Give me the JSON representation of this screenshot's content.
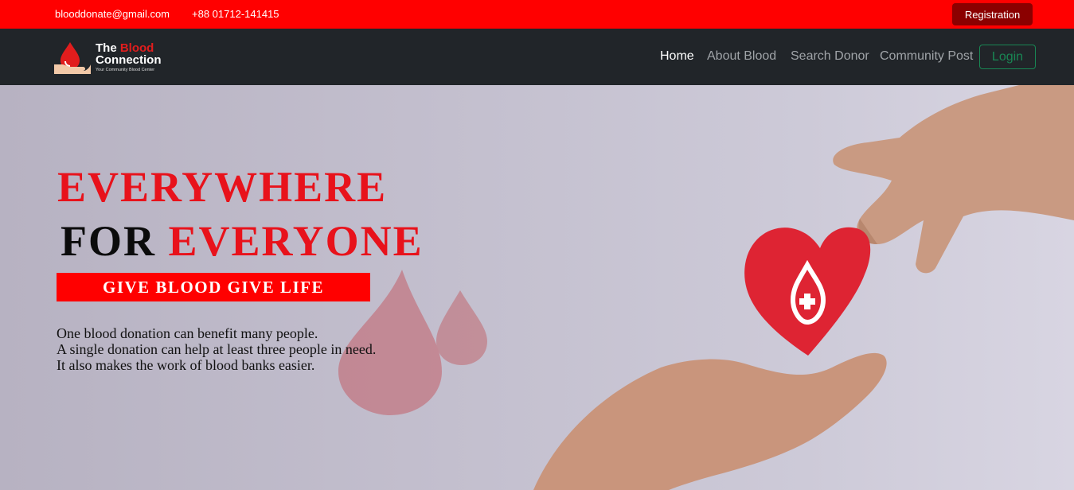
{
  "topbar": {
    "email": "blooddonate@gmail.com",
    "phone": "+88 01712-141415",
    "registration_label": "Registration"
  },
  "brand": {
    "line1_prefix": "The ",
    "line1_highlight": "Blood",
    "line2": "Connection",
    "tagline": "Your Community Blood Center"
  },
  "nav": {
    "items": [
      {
        "label": "Home",
        "active": true
      },
      {
        "label": "About Blood",
        "active": false
      },
      {
        "label": "Search Donor",
        "active": false
      },
      {
        "label": "Community Post",
        "active": false
      }
    ],
    "login_label": "Login"
  },
  "hero": {
    "heading_line1": "EVERYWHERE",
    "heading_line2_black": "FOR",
    "heading_line2_red": "EVERYONE",
    "tagline": "GIVE BLOOD GIVE LIFE",
    "description": [
      "One blood donation can benefit many people.",
      "A single donation can help at least three people in need.",
      "It also makes the work of blood banks easier."
    ]
  },
  "colors": {
    "topbar_red": "#ff0000",
    "navbar_dark": "#212529",
    "registration_btn": "#8b0000",
    "login_green": "#198754",
    "heading_red": "#e8121b"
  }
}
